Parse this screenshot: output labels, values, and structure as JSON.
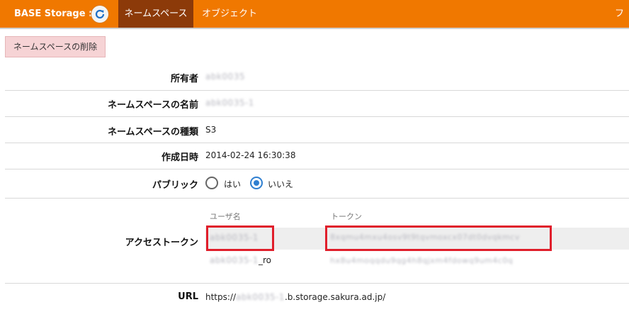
{
  "header": {
    "brand": "BASE Storage :",
    "tabs": [
      {
        "label": "ネームスペース",
        "active": true
      },
      {
        "label": "オブジェクト",
        "active": false
      }
    ],
    "cut_tab": "フ",
    "bg_color": "#f07800",
    "active_tab_color": "#8c3a09"
  },
  "actions": {
    "delete_namespace": "ネームスペースの削除"
  },
  "details": {
    "owner_label": "所有者",
    "owner_value": "abk0035",
    "ns_name_label": "ネームスペースの名前",
    "ns_name_value": "abk0035-1",
    "ns_type_label": "ネームスペースの種類",
    "ns_type_value": "S3",
    "created_label": "作成日時",
    "created_value": "2014-02-24 16:30:38",
    "public_label": "パブリック",
    "public_yes": "はい",
    "public_no": "いいえ",
    "public_selected": "いいえ",
    "access_token_label": "アクセストークン",
    "url_label": "URL",
    "url_prefix": "https://",
    "url_blurred": "abk0035-1",
    "url_suffix": ".b.storage.sakura.ad.jp/"
  },
  "token_table": {
    "col_user": "ユーザ名",
    "col_token": "トークン",
    "rows": [
      {
        "user": "abk0035-1",
        "user_suffix": "",
        "token": "8xqmu4mxu4osv9t9tqvmoxcx07dt0dvqkmcv"
      },
      {
        "user": "abk0035-1",
        "user_suffix": "_ro",
        "token": "hx8u4moqqdu9qg4h8qjxm4fdowq9um4c0q"
      }
    ]
  },
  "highlight_color": "#e01e2b"
}
